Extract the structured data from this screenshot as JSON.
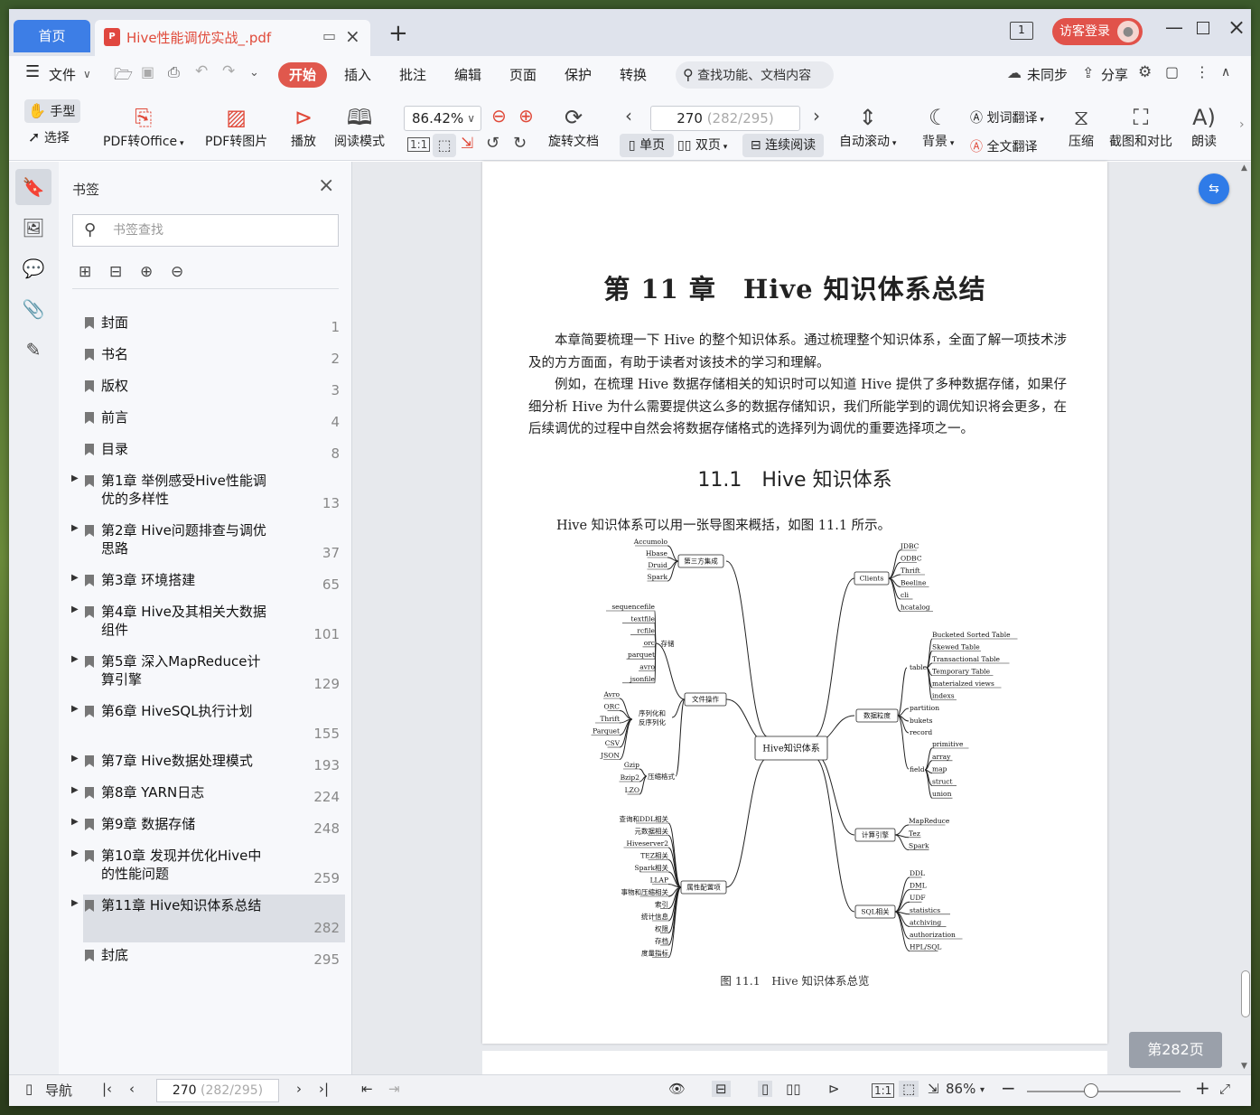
{
  "tabs": {
    "home": "首页",
    "doc_title": "Hive性能调优实战_.pdf",
    "new_tab": "+"
  },
  "window": {
    "badge": "1",
    "login": "访客登录"
  },
  "menu": {
    "file": "文件",
    "items": [
      "开始",
      "插入",
      "批注",
      "编辑",
      "页面",
      "保护",
      "转换"
    ],
    "search": "查找功能、文档内容",
    "sync": "未同步",
    "share": "分享"
  },
  "toolbar": {
    "hand": "手型",
    "select": "选择",
    "pdf_office": "PDF转Office",
    "pdf_image": "PDF转图片",
    "play": "播放",
    "read_mode": "阅读模式",
    "zoom": "86.42%",
    "rotate": "旋转文档",
    "page_current": "270",
    "page_total": "(282/295)",
    "single": "单页",
    "double": "双页",
    "continuous": "连续阅读",
    "autoscroll": "自动滚动",
    "background": "背景",
    "word_translate": "划词翻译",
    "full_translate": "全文翻译",
    "compress": "压缩",
    "screenshot": "截图和对比",
    "read_aloud": "朗读"
  },
  "bookmarks": {
    "title": "书签",
    "search_placeholder": "书签查找",
    "items": [
      {
        "label": "封面",
        "page": "1",
        "expandable": false
      },
      {
        "label": "书名",
        "page": "2",
        "expandable": false
      },
      {
        "label": "版权",
        "page": "3",
        "expandable": false
      },
      {
        "label": "前言",
        "page": "4",
        "expandable": false
      },
      {
        "label": "目录",
        "page": "8",
        "expandable": false
      },
      {
        "label": "第1章 举例感受Hive性能调优的多样性",
        "page": "13",
        "expandable": true
      },
      {
        "label": "第2章 Hive问题排查与调优思路",
        "page": "37",
        "expandable": true
      },
      {
        "label": "第3章 环境搭建",
        "page": "65",
        "expandable": true
      },
      {
        "label": "第4章 Hive及其相关大数据组件",
        "page": "101",
        "expandable": true
      },
      {
        "label": "第5章 深入MapReduce计算引擎",
        "page": "129",
        "expandable": true
      },
      {
        "label": "第6章 HiveSQL执行计划",
        "page": "155",
        "expandable": true
      },
      {
        "label": "第7章 Hive数据处理模式",
        "page": "193",
        "expandable": true
      },
      {
        "label": "第8章 YARN日志",
        "page": "224",
        "expandable": true
      },
      {
        "label": "第9章 数据存储",
        "page": "248",
        "expandable": true
      },
      {
        "label": "第10章 发现并优化Hive中的性能问题",
        "page": "259",
        "expandable": true
      },
      {
        "label": "第11章 Hive知识体系总结",
        "page": "282",
        "expandable": true
      },
      {
        "label": "封底",
        "page": "295",
        "expandable": false
      }
    ]
  },
  "document": {
    "chapter_title": "第 11 章　Hive 知识体系总结",
    "para1": "本章简要梳理一下 Hive 的整个知识体系。通过梳理整个知识体系，全面了解一项技术涉及的方方面面，有助于读者对该技术的学习和理解。",
    "para2": "例如，在梳理 Hive 数据存储相关的知识时可以知道 Hive 提供了多种数据存储，如果仔细分析 Hive 为什么需要提供这么多的数据存储知识，我们所能学到的调优知识将会更多，在后续调优的过程中自然会将数据存储格式的选择列为调优的重要选择项之一。",
    "section_title": "11.1　Hive 知识体系",
    "para3": "Hive 知识体系可以用一张导图来概括，如图 11.1 所示。",
    "figure_caption": "图 11.1　Hive 知识体系总览",
    "page_badge": "第282页",
    "mindmap": {
      "center": "Hive知识体系",
      "branches": [
        {
          "name": "第三方集成",
          "leaves": [
            "Accumolo",
            "Hbase",
            "Druid",
            "Spark"
          ]
        },
        {
          "name": "存储",
          "leaves": [
            "sequencefile",
            "textfile",
            "rcfile",
            "orc",
            "parquet",
            "avro",
            "jsonfile"
          ]
        },
        {
          "name": "文件操作"
        },
        {
          "name": "序列化和\n反序列化",
          "leaves": [
            "Avro",
            "ORC",
            "Thrift",
            "Parquet",
            "CSV",
            "JSON"
          ]
        },
        {
          "name": "压缩格式",
          "leaves": [
            "Gzip",
            "Bzip2",
            "LZO"
          ]
        },
        {
          "name": "属性配置项",
          "leaves": [
            "查询和DDL相关",
            "元数据相关",
            "Hiveserver2",
            "TEZ相关",
            "Spark相关",
            "LLAP",
            "事物和压缩相关",
            "索引",
            "统计信息",
            "权限",
            "存档",
            "度量指标"
          ]
        },
        {
          "name": "Clients",
          "leaves": [
            "JDBC",
            "ODBC",
            "Thrift",
            "Beeline",
            "cli",
            "hcatalog"
          ]
        },
        {
          "name": "数据粒度"
        },
        {
          "name": "table",
          "leaves": [
            "Bucketed Sorted Table",
            "Skewed Table",
            "Transactional Table",
            "Temporary Table",
            "materialzed views",
            "indexs"
          ]
        },
        {
          "name": "partition"
        },
        {
          "name": "bukets"
        },
        {
          "name": "record"
        },
        {
          "name": "field",
          "leaves": [
            "primitive",
            "array",
            "map",
            "struct",
            "union"
          ]
        },
        {
          "name": "计算引擎",
          "leaves": [
            "MapReduce",
            "Tez",
            "Spark"
          ]
        },
        {
          "name": "SQL相关",
          "leaves": [
            "DDL",
            "DML",
            "UDF",
            "statistics",
            "atchiving",
            "authorization",
            "HPL/SQL"
          ]
        }
      ]
    }
  },
  "statusbar": {
    "nav": "导航",
    "page_current": "270",
    "page_total": "(282/295)",
    "zoom": "86%"
  }
}
